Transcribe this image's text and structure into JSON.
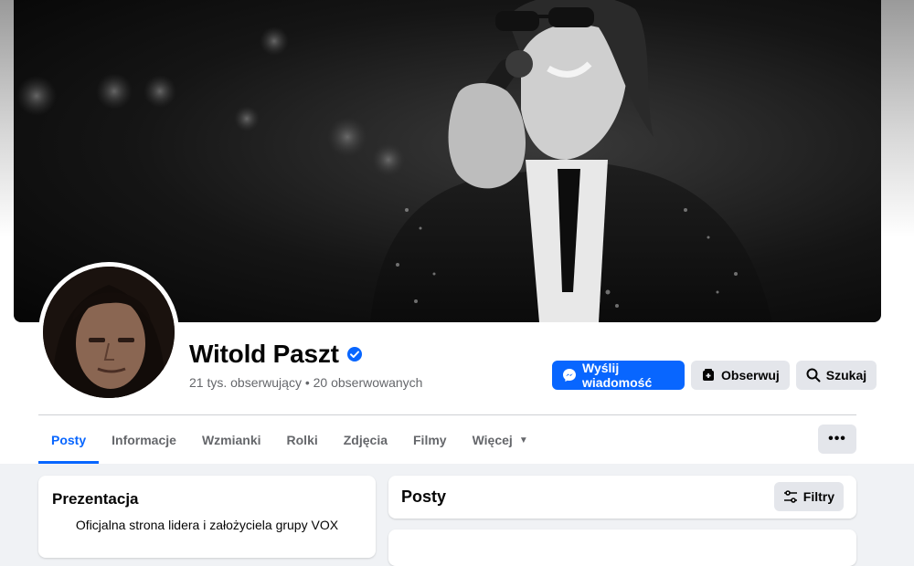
{
  "profile": {
    "name": "Witold Paszt",
    "verified": true,
    "stats": "21 tys. obserwujący • 20 obserwowanych"
  },
  "actions": {
    "message_label": "Wyślij wiadomość",
    "follow_label": "Obserwuj",
    "search_label": "Szukaj"
  },
  "tabs": [
    {
      "label": "Posty",
      "active": true
    },
    {
      "label": "Informacje"
    },
    {
      "label": "Wzmianki"
    },
    {
      "label": "Rolki"
    },
    {
      "label": "Zdjęcia"
    },
    {
      "label": "Filmy"
    },
    {
      "label": "Więcej"
    }
  ],
  "intro": {
    "title": "Prezentacja",
    "text": "Oficjalna strona lidera i założyciela grupy VOX"
  },
  "posts": {
    "title": "Posty",
    "filter_label": "Filtry"
  },
  "colors": {
    "accent": "#0866ff",
    "secondary_button": "#e4e6eb",
    "muted_text": "#65676b",
    "page_background": "#f0f2f5"
  },
  "icons": {
    "verified": "verified-badge-icon",
    "messenger": "messenger-icon",
    "follow": "follow-icon",
    "search": "search-icon",
    "more": "more-dots-icon",
    "filter": "filter-sliders-icon",
    "dropdown": "caret-down-icon"
  }
}
